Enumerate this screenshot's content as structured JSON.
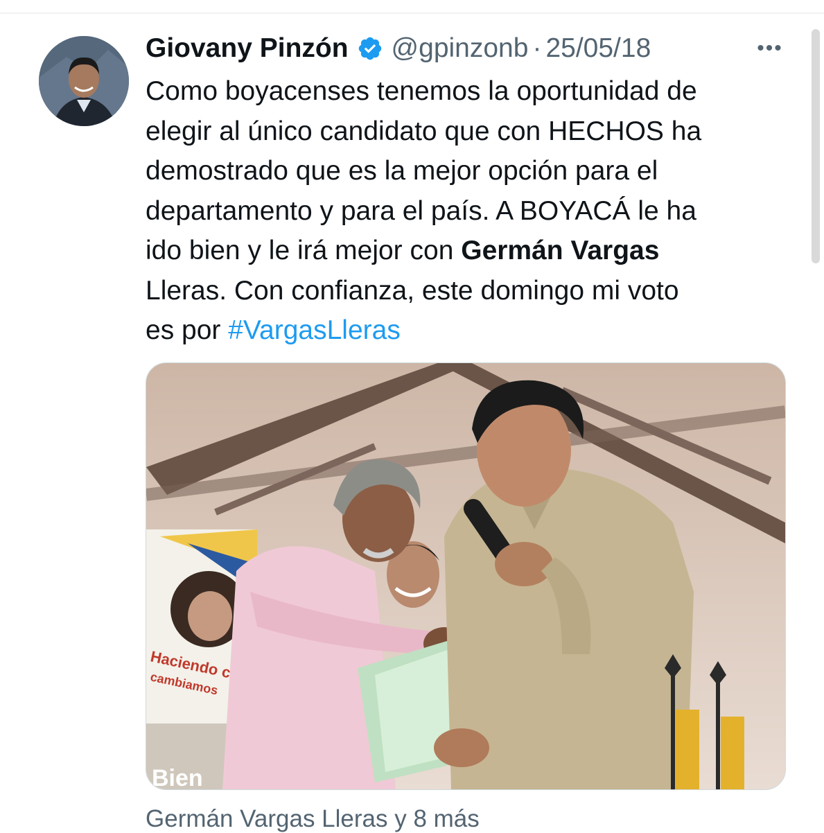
{
  "tweet": {
    "author_name": "Giovany Pinzón",
    "handle": "@gpinzonb",
    "separator": "·",
    "date": "25/05/18",
    "more_icon": "more-horizontal-icon",
    "verified_icon": "verified-badge-icon",
    "text_parts": [
      {
        "text": "Como boyacenses tenemos la oportunidad de\nelegir al único candidato que con HECHOS ha\ndemostrado que es la mejor opción para el\ndepartamento y para el país. A BOYACÁ le ha\nido bien y le irá mejor con "
      },
      {
        "text": "Germán Vargas"
      },
      {
        "text": "\nLleras. Con confianza, este domingo mi voto\nes por "
      },
      {
        "text": "#VargasLleras"
      }
    ],
    "tagged_people": "Germán Vargas Lleras y 8 más"
  },
  "photo": {
    "poster_text_1": "Haciendo c",
    "poster_text_2": "cambiamos",
    "poster_text_3": "Bien"
  },
  "colors": {
    "hashtag": "#1d9bf0",
    "secondary_text": "#536471",
    "verified": "#1d9bf0"
  }
}
